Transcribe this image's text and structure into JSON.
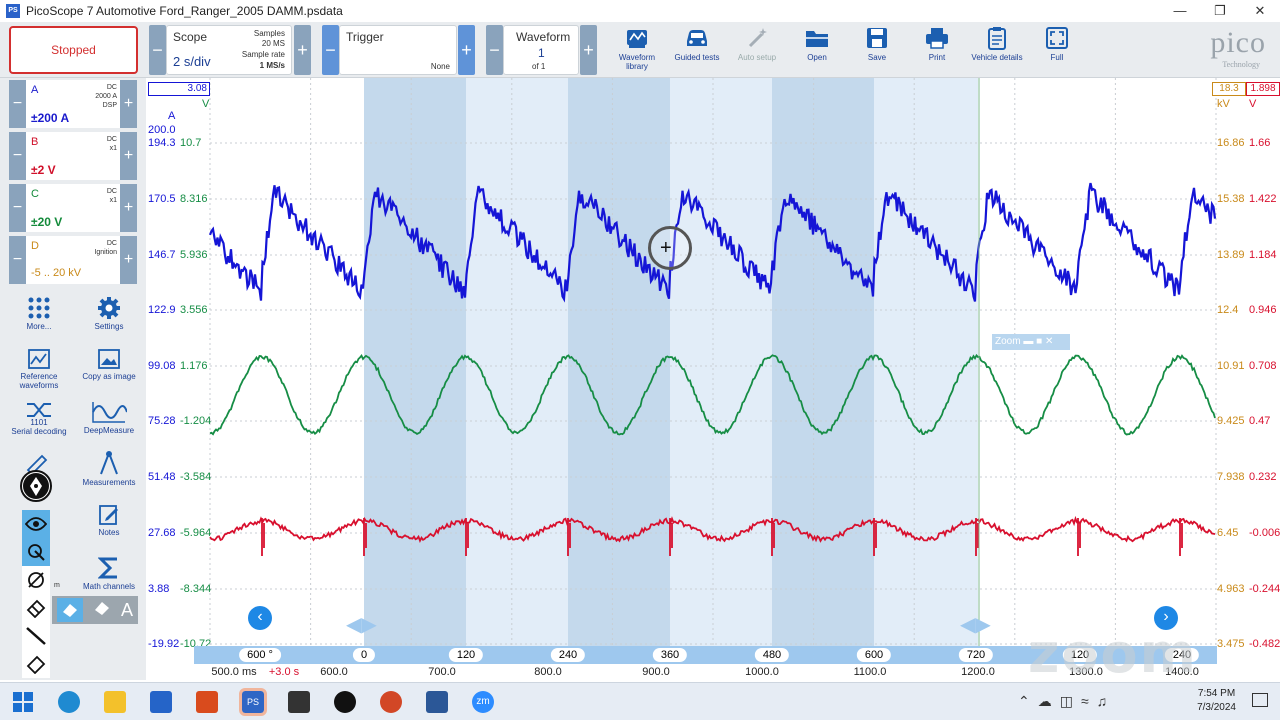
{
  "window": {
    "title": "PicoScope 7 Automotive Ford_Ranger_2005 DAMM.psdata",
    "app_icon": "PS"
  },
  "toolbar": {
    "status": "Stopped",
    "scope": {
      "label": "Scope",
      "value": "2 s/div",
      "samples_label": "Samples",
      "samples": "20 MS",
      "rate_label": "Sample rate",
      "rate": "1 MS/s"
    },
    "trigger": {
      "label": "Trigger",
      "mode": "None"
    },
    "waveform": {
      "label": "Waveform",
      "current": "1",
      "of": "of 1"
    },
    "buttons": [
      {
        "label": "Waveform library",
        "icon": "books-icon"
      },
      {
        "label": "Guided tests",
        "icon": "car-icon"
      },
      {
        "label": "Auto setup",
        "icon": "wand-icon",
        "disabled": true
      },
      {
        "label": "Open",
        "icon": "folder-icon"
      },
      {
        "label": "Save",
        "icon": "floppy-icon"
      },
      {
        "label": "Print",
        "icon": "printer-icon"
      },
      {
        "label": "Vehicle details",
        "icon": "clipboard-icon"
      },
      {
        "label": "Full",
        "icon": "fullscreen-icon"
      }
    ],
    "brand": "pico",
    "brand_sub": "Technology"
  },
  "channels": [
    {
      "name": "A",
      "coupling": "DC",
      "probe": "2000 A",
      "extra": "DSP",
      "range": "±200 A",
      "color": "#1a1acc"
    },
    {
      "name": "B",
      "coupling": "DC",
      "probe": "x1",
      "extra": "",
      "range": "±2 V",
      "color": "#d0102a"
    },
    {
      "name": "C",
      "coupling": "DC",
      "probe": "x1",
      "extra": "",
      "range": "±20 V",
      "color": "#138a3a"
    },
    {
      "name": "D",
      "coupling": "DC",
      "probe": "Ignition",
      "extra": "",
      "range": "-5 .. 20 kV",
      "color": "#c98a1a"
    }
  ],
  "tools": {
    "more": "More...",
    "settings": "Settings",
    "reference": "Reference waveforms",
    "copy_image": "Copy as image",
    "serial": "Serial decoding",
    "serial_num": "1101",
    "deepmeasure": "DeepMeasure",
    "measurements": "Measurements",
    "notes": "Notes",
    "math": "Math channels",
    "text_tool": "A",
    "partial_label": "m"
  },
  "axes": {
    "left_a_unit": "A",
    "left_c_unit": "V",
    "right_d_unit": "kV",
    "right_b_unit": "V",
    "left_a_cursor": "3.08",
    "right_cursor_d": "18.3",
    "right_cursor_b": "1.898",
    "left_a": [
      "200.0",
      "194.3",
      "170.5",
      "146.7",
      "122.9",
      "99.08",
      "75.28",
      "51.48",
      "27.68",
      "3.88",
      "-19.92"
    ],
    "left_c": [
      "10.7",
      "8.316",
      "5.936",
      "3.556",
      "1.176",
      "-1.204",
      "-3.584",
      "-5.964",
      "-8.344",
      "-10.72"
    ],
    "right_d": [
      "16.86",
      "15.38",
      "13.89",
      "12.4",
      "10.91",
      "9.425",
      "7.938",
      "6.45",
      "4.963",
      "3.475"
    ],
    "right_b": [
      "1.66",
      "1.422",
      "1.184",
      "0.946",
      "0.708",
      "0.47",
      "0.232",
      "-0.006",
      "-0.244",
      "-0.482"
    ]
  },
  "zoom_overlay": "Zoom",
  "phase_labels": [
    "600 °",
    "0",
    "120",
    "240",
    "360",
    "480",
    "600",
    "720",
    "120",
    "240"
  ],
  "time_labels": [
    "500.0 ms",
    "+3.0 s",
    "600.0",
    "700.0",
    "800.0",
    "900.0",
    "1000.0",
    "1100.0",
    "1200.0",
    "1300.0",
    "1400.0"
  ],
  "watermark": "zoom",
  "taskbar": {
    "time": "7:54 PM",
    "date": "7/3/2024",
    "apps": [
      "start-icon",
      "search-icon",
      "edge-icon",
      "explorer-icon",
      "store-icon",
      "app-icon",
      "picoscope-icon",
      "tool-icon",
      "pico-icon",
      "powerpoint-icon",
      "word-icon",
      "zoom-icon"
    ],
    "zoom_app_text": "zm"
  }
}
